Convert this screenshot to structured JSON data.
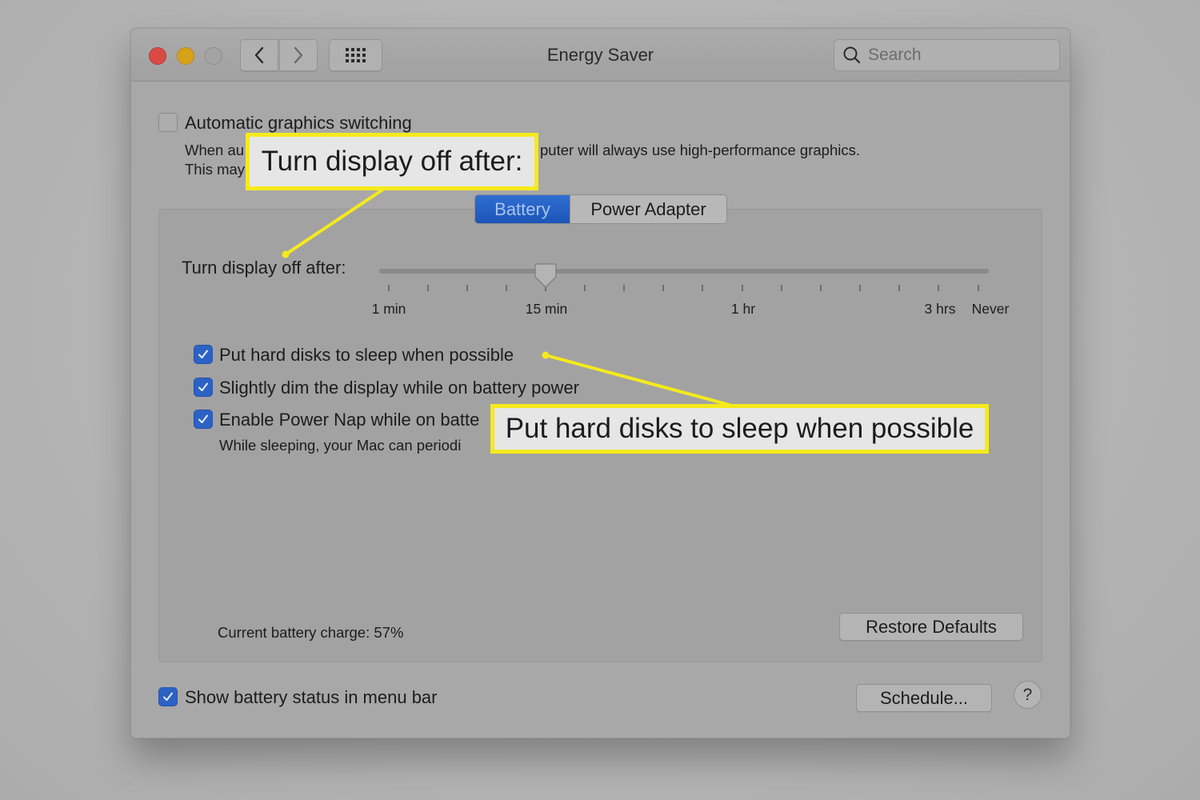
{
  "window": {
    "title": "Energy Saver",
    "search_placeholder": "Search"
  },
  "graphics": {
    "checkbox_label": "Automatic graphics switching",
    "checked": false,
    "description_line1_start": "When au",
    "description_line1_end": "puter will always use high-performance graphics.",
    "description_line2_start": "This may"
  },
  "tabs": [
    {
      "label": "Battery",
      "active": true
    },
    {
      "label": "Power Adapter",
      "active": false
    }
  ],
  "display_sleep": {
    "label": "Turn display off after:",
    "selected_value": "15 min",
    "tick_labels": [
      "1 min",
      "15 min",
      "1 hr",
      "3 hrs",
      "Never"
    ]
  },
  "options": [
    {
      "label": "Put hard disks to sleep when possible",
      "checked": true
    },
    {
      "label": "Slightly dim the display while on battery power",
      "checked": true
    },
    {
      "label": "Enable Power Nap while on batte",
      "checked": true
    }
  ],
  "power_nap_description": "While sleeping, your Mac can periodi",
  "battery_charge": "Current battery charge: 57%",
  "buttons": {
    "restore_defaults": "Restore Defaults",
    "schedule": "Schedule...",
    "help": "?"
  },
  "menu_bar_option": {
    "label": "Show battery status in menu bar",
    "checked": true
  },
  "callouts": [
    {
      "text": "Turn display off after:"
    },
    {
      "text": "Put hard disks to sleep when possible"
    }
  ],
  "colors": {
    "accent_blue": "#2c62c4",
    "callout_yellow": "#f5ea1c",
    "close": "#d94a45",
    "minimize": "#d6a21c"
  }
}
